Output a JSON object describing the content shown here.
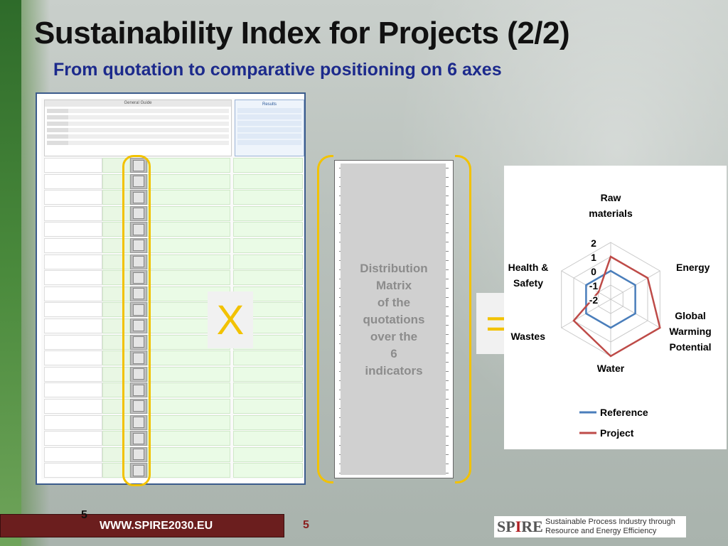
{
  "slide": {
    "title": "Sustainability Index for Projects (2/2)",
    "subtitle": "From quotation to comparative positioning on 6 axes"
  },
  "spreadsheet": {
    "general_guide": "General Guide",
    "results": "Results"
  },
  "operators": {
    "multiply": "X",
    "equals": "="
  },
  "matrix": {
    "label_lines": [
      "Distribution",
      "Matrix",
      "of the",
      "quotations",
      "over the",
      "6",
      "indicators"
    ]
  },
  "chart_data": {
    "type": "radar",
    "axes": [
      "Raw materials",
      "Energy",
      "Global Warming Potential",
      "Water",
      "Wastes",
      "Health & Safety"
    ],
    "axis_label_lines": [
      [
        "Raw",
        "materials"
      ],
      [
        "Energy"
      ],
      [
        "Global",
        "Warming",
        "Potential"
      ],
      [
        "Water"
      ],
      [
        "Wastes"
      ],
      [
        "Health &",
        "Safety"
      ]
    ],
    "ticks": [
      "2",
      "1",
      "0",
      "-1",
      "-2"
    ],
    "range": [
      -2,
      2
    ],
    "series": [
      {
        "name": "Reference",
        "color": "#4a7ebb",
        "values": [
          0,
          0,
          0,
          0,
          0,
          0
        ]
      },
      {
        "name": "Project",
        "color": "#be4b48",
        "values": [
          1,
          1,
          2,
          2,
          1,
          -1
        ]
      }
    ],
    "legend_position": "bottom"
  },
  "footer": {
    "page_small": "5",
    "url": "WWW.SPIRE2030.EU",
    "page": "5",
    "logo_text_1": "Sustainable Process Industry through",
    "logo_text_2": "Resource and Energy Efficiency"
  }
}
